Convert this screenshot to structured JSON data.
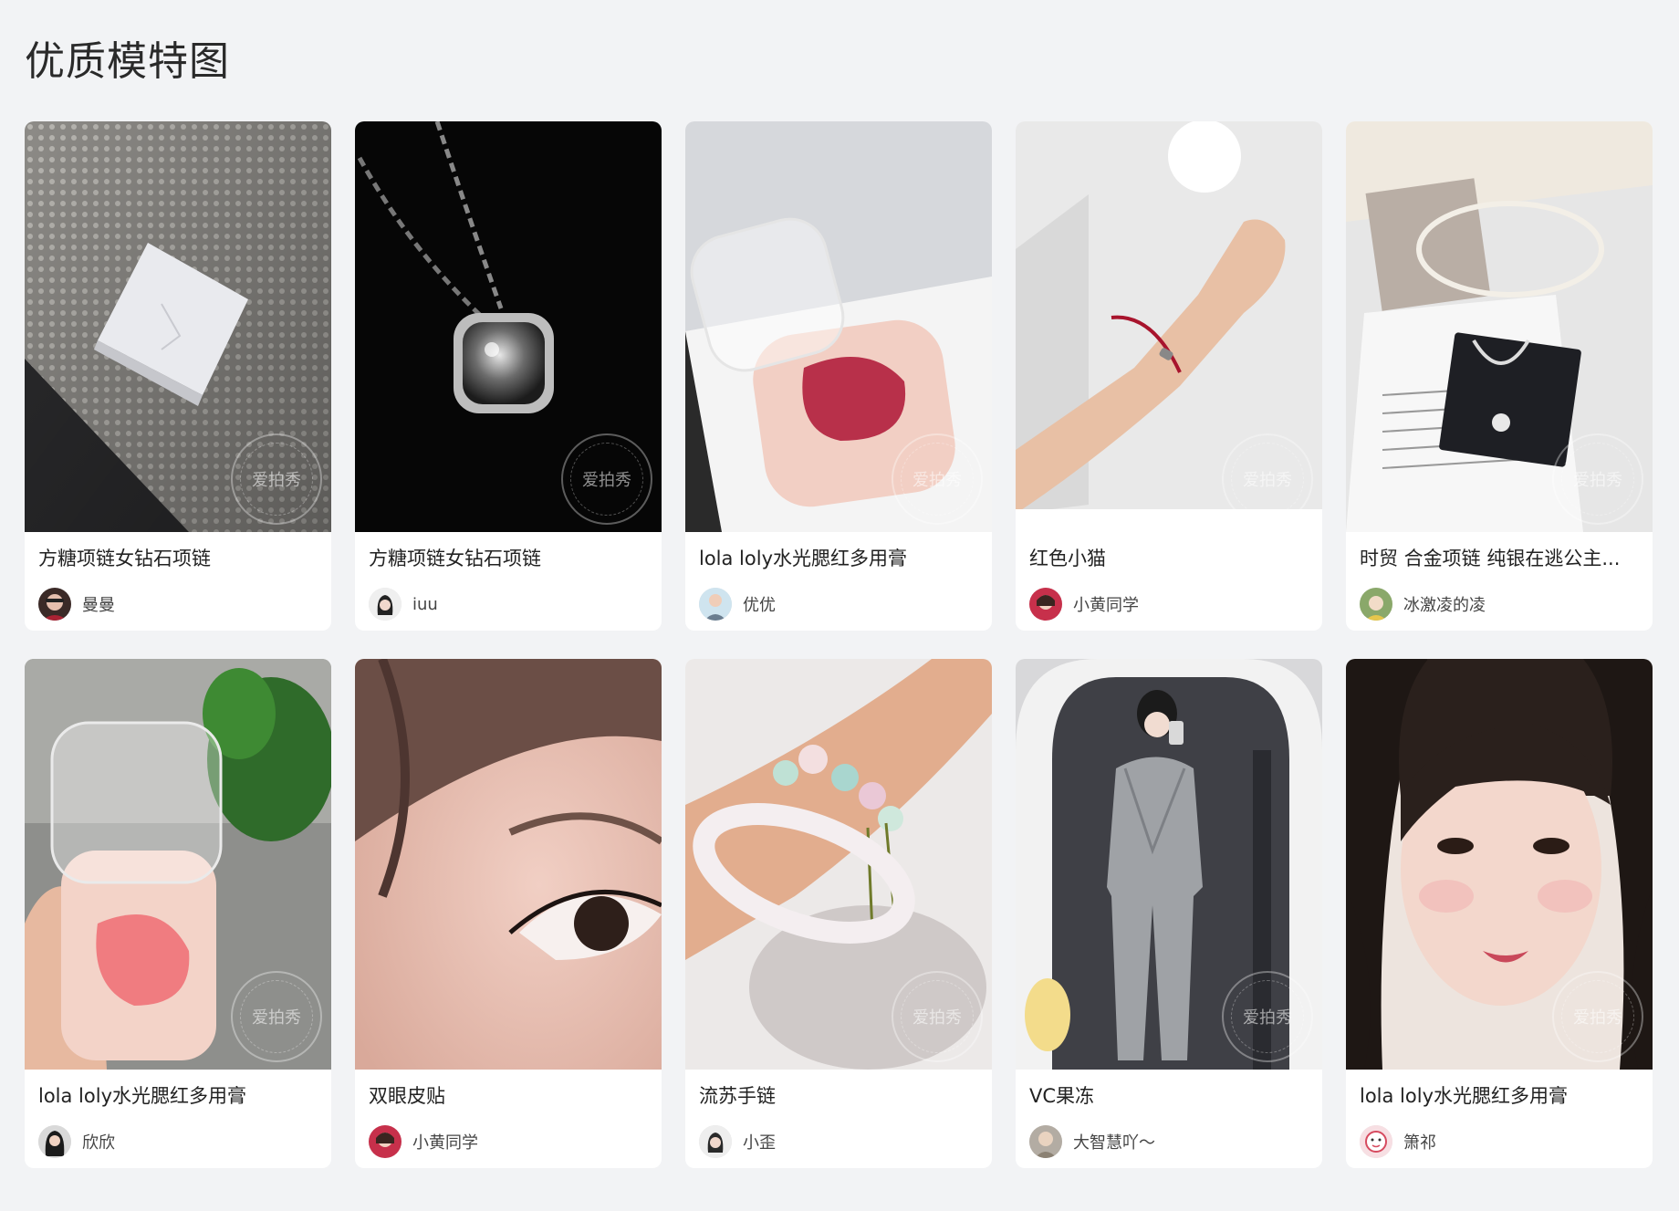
{
  "page": {
    "title": "优质模特图"
  },
  "watermark": "爱拍秀",
  "cards": [
    {
      "title": "方糖项链女钻石项链",
      "author": "曼曼",
      "image": "white-square-box-on-dotted-fabric"
    },
    {
      "title": "方糖项链女钻石项链",
      "author": "iuu",
      "image": "crystal-pendant-necklace-black-background"
    },
    {
      "title": "lola loly水光腮红多用膏",
      "author": "优优",
      "image": "blush-compact-on-white-table"
    },
    {
      "title": "红色小猫",
      "author": "小黄同学",
      "image": "red-string-bracelet-on-wrist"
    },
    {
      "title": "时贸 合金项链 纯银在逃公主...",
      "author": "冰激凌的凌",
      "image": "drop-necklace-on-magazine"
    },
    {
      "title": "lola loly水光腮红多用膏",
      "author": "欣欣",
      "image": "hand-holding-blush-compact"
    },
    {
      "title": "双眼皮贴",
      "author": "小黄同学",
      "image": "eye-closeup"
    },
    {
      "title": "流苏手链",
      "author": "小歪",
      "image": "beaded-bracelet-with-bangle"
    },
    {
      "title": "VC果冻",
      "author": "大智慧吖～",
      "image": "mirror-selfie-grey-suit"
    },
    {
      "title": "lola loly水光腮红多用膏",
      "author": "箫祁",
      "image": "portrait-long-hair"
    }
  ]
}
